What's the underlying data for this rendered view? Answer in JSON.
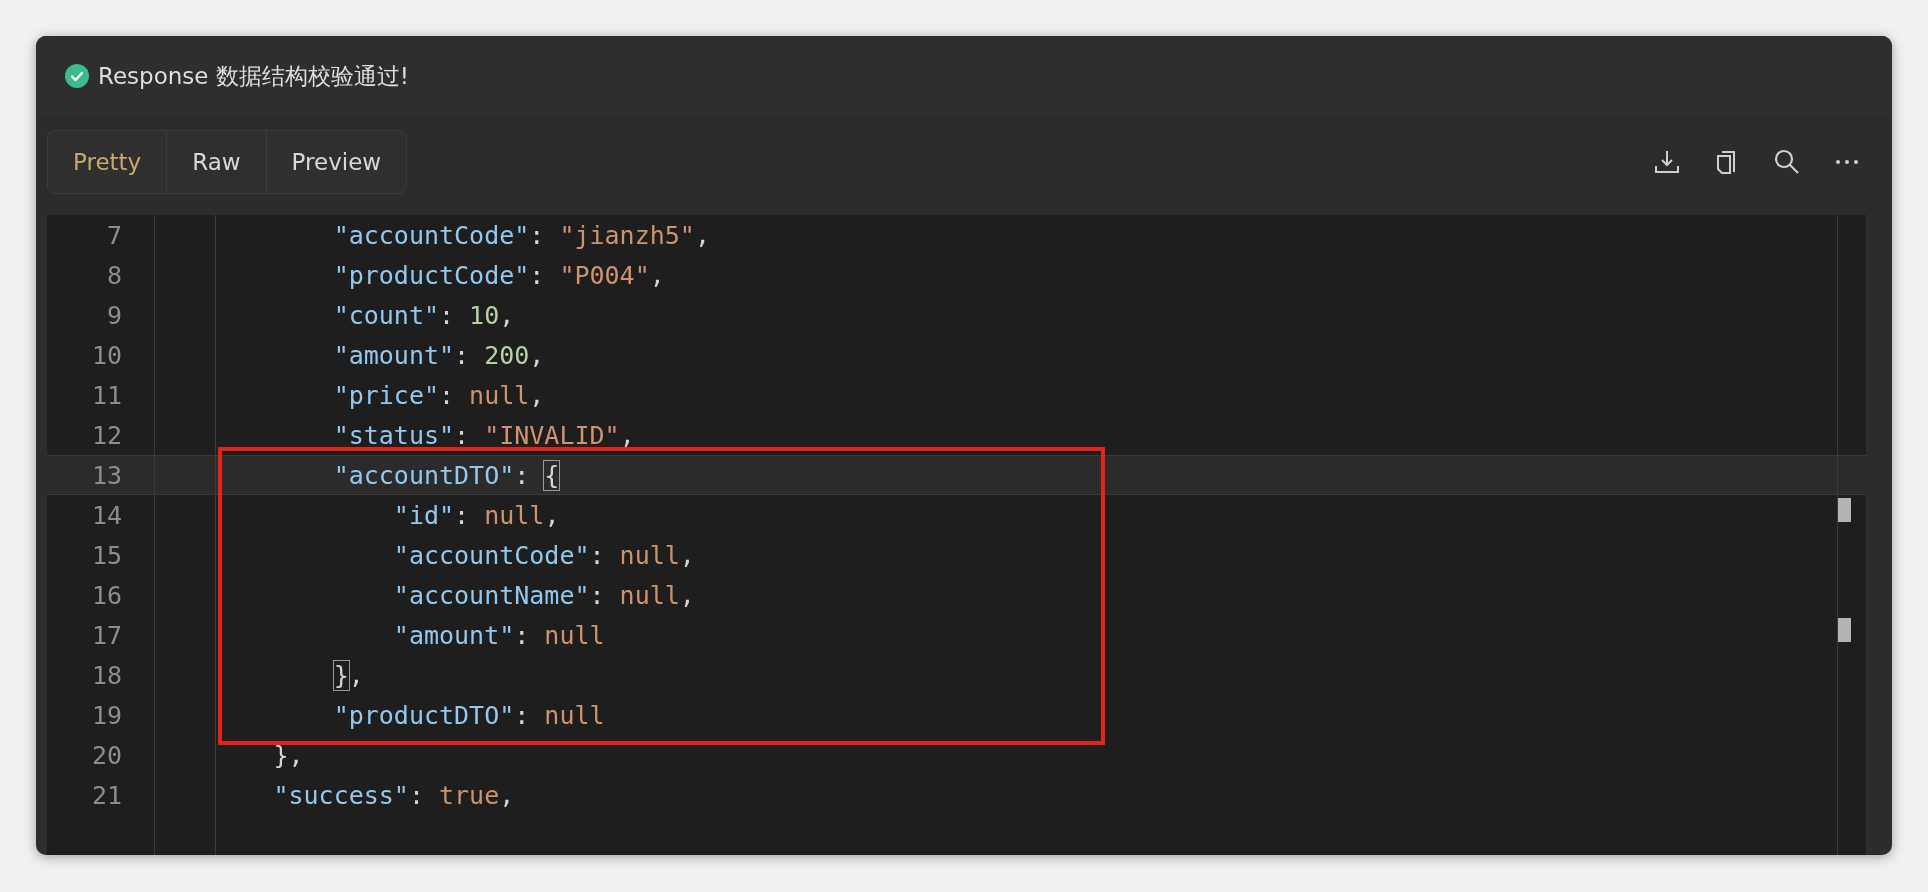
{
  "status": {
    "message": "Response 数据结构校验通过!"
  },
  "tabs": [
    {
      "label": "Pretty",
      "selected": true
    },
    {
      "label": "Raw",
      "selected": false
    },
    {
      "label": "Preview",
      "selected": false
    }
  ],
  "lines": [
    {
      "number": "7",
      "current": false,
      "tokens": [
        {
          "kind": "key",
          "text": "            \"accountCode\""
        },
        {
          "kind": "punct",
          "text": ": "
        },
        {
          "kind": "string",
          "text": "\"jianzh5\""
        },
        {
          "kind": "punct",
          "text": ","
        }
      ]
    },
    {
      "number": "8",
      "current": false,
      "tokens": [
        {
          "kind": "key",
          "text": "            \"productCode\""
        },
        {
          "kind": "punct",
          "text": ": "
        },
        {
          "kind": "string",
          "text": "\"P004\""
        },
        {
          "kind": "punct",
          "text": ","
        }
      ]
    },
    {
      "number": "9",
      "current": false,
      "tokens": [
        {
          "kind": "key",
          "text": "            \"count\""
        },
        {
          "kind": "punct",
          "text": ": "
        },
        {
          "kind": "number",
          "text": "10"
        },
        {
          "kind": "punct",
          "text": ","
        }
      ]
    },
    {
      "number": "10",
      "current": false,
      "tokens": [
        {
          "kind": "key",
          "text": "            \"amount\""
        },
        {
          "kind": "punct",
          "text": ": "
        },
        {
          "kind": "number",
          "text": "200"
        },
        {
          "kind": "punct",
          "text": ","
        }
      ]
    },
    {
      "number": "11",
      "current": false,
      "tokens": [
        {
          "kind": "key",
          "text": "            \"price\""
        },
        {
          "kind": "punct",
          "text": ": "
        },
        {
          "kind": "literal",
          "text": "null"
        },
        {
          "kind": "punct",
          "text": ","
        }
      ]
    },
    {
      "number": "12",
      "current": false,
      "tokens": [
        {
          "kind": "key",
          "text": "            \"status\""
        },
        {
          "kind": "punct",
          "text": ": "
        },
        {
          "kind": "string",
          "text": "\"INVALID\""
        },
        {
          "kind": "punct",
          "text": ","
        }
      ]
    },
    {
      "number": "13",
      "current": true,
      "tokens": [
        {
          "kind": "key",
          "text": "            \"accountDTO\""
        },
        {
          "kind": "punct",
          "text": ": "
        },
        {
          "kind": "bracket",
          "text": "{",
          "matched": true
        }
      ]
    },
    {
      "number": "14",
      "current": false,
      "tokens": [
        {
          "kind": "key",
          "text": "                \"id\""
        },
        {
          "kind": "punct",
          "text": ": "
        },
        {
          "kind": "literal",
          "text": "null"
        },
        {
          "kind": "punct",
          "text": ","
        }
      ]
    },
    {
      "number": "15",
      "current": false,
      "tokens": [
        {
          "kind": "key",
          "text": "                \"accountCode\""
        },
        {
          "kind": "punct",
          "text": ": "
        },
        {
          "kind": "literal",
          "text": "null"
        },
        {
          "kind": "punct",
          "text": ","
        }
      ]
    },
    {
      "number": "16",
      "current": false,
      "tokens": [
        {
          "kind": "key",
          "text": "                \"accountName\""
        },
        {
          "kind": "punct",
          "text": ": "
        },
        {
          "kind": "literal",
          "text": "null"
        },
        {
          "kind": "punct",
          "text": ","
        }
      ]
    },
    {
      "number": "17",
      "current": false,
      "tokens": [
        {
          "kind": "key",
          "text": "                \"amount\""
        },
        {
          "kind": "punct",
          "text": ": "
        },
        {
          "kind": "literal",
          "text": "null"
        }
      ]
    },
    {
      "number": "18",
      "current": false,
      "tokens": [
        {
          "kind": "bracket",
          "text": "            }",
          "matched": true
        },
        {
          "kind": "punct",
          "text": ","
        }
      ]
    },
    {
      "number": "19",
      "current": false,
      "tokens": [
        {
          "kind": "key",
          "text": "            \"productDTO\""
        },
        {
          "kind": "punct",
          "text": ": "
        },
        {
          "kind": "literal",
          "text": "null"
        }
      ]
    },
    {
      "number": "20",
      "current": false,
      "tokens": [
        {
          "kind": "punct",
          "text": "        },"
        }
      ]
    },
    {
      "number": "21",
      "current": false,
      "tokens": [
        {
          "kind": "key",
          "text": "        \"success\""
        },
        {
          "kind": "punct",
          "text": ": "
        },
        {
          "kind": "literal",
          "text": "true"
        },
        {
          "kind": "punct",
          "text": ","
        }
      ]
    }
  ]
}
